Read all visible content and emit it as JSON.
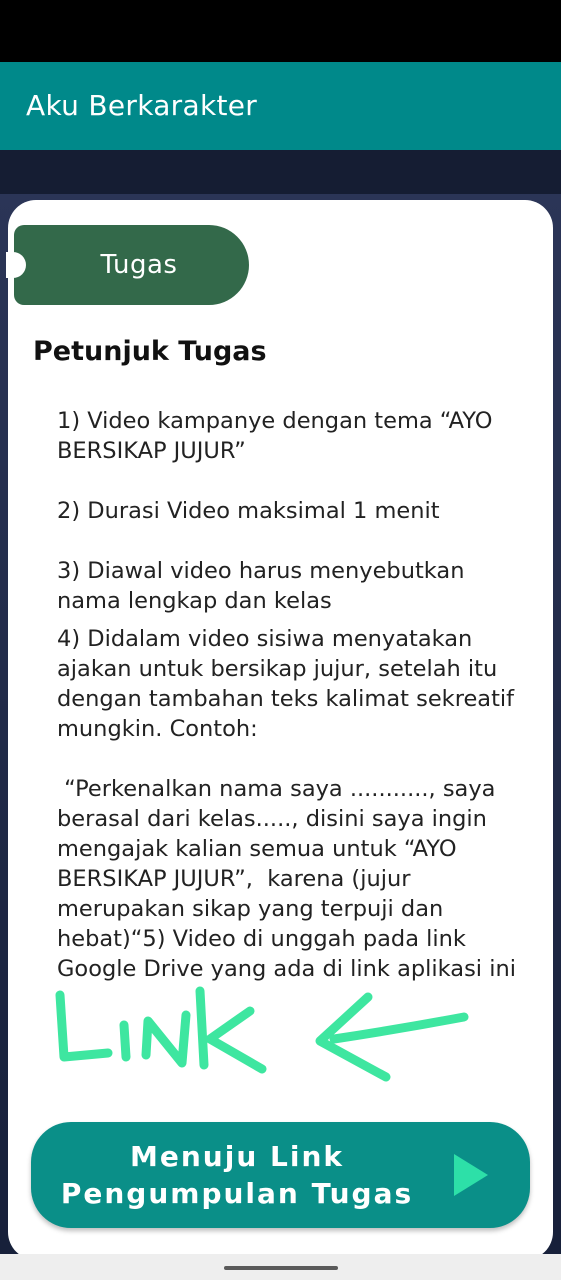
{
  "app_bar": {
    "title": "Aku Berkarakter"
  },
  "tab": {
    "label": "Tugas"
  },
  "content": {
    "heading": "Petunjuk Tugas",
    "items": [
      "1) Video kampanye dengan tema “AYO BERSIKAP JUJUR”",
      "2) Durasi Video maksimal 1 menit",
      "3) Diawal video harus menyebutkan nama lengkap dan kelas",
      "4) Didalam video sisiwa menyatakan ajakan untuk bersikap jujur, setelah itu dengan tambahan teks kalimat sekreatif mungkin. Contoh:",
      " “Perkenalkan nama saya ..........., saya berasal dari kelas....., disini saya ingin mengajak kalian semua untuk “AYO BERSIKAP JUJUR”,  karena (jujur merupakan sikap yang terpuji dan hebat)“5) Video di unggah pada link Google Drive yang ada di link aplikasi ini"
    ]
  },
  "annotation": {
    "text": "LINK",
    "icon": "arrow-left-icon",
    "color": "#3ee6a0"
  },
  "cta": {
    "line1": "Menuju Link",
    "line2": "Pengumpulan Tugas",
    "icon": "play-icon",
    "color": "#0a8f88"
  },
  "colors": {
    "app_bar": "#00898a",
    "tab": "#33694a",
    "play_icon": "#2de0a8"
  }
}
